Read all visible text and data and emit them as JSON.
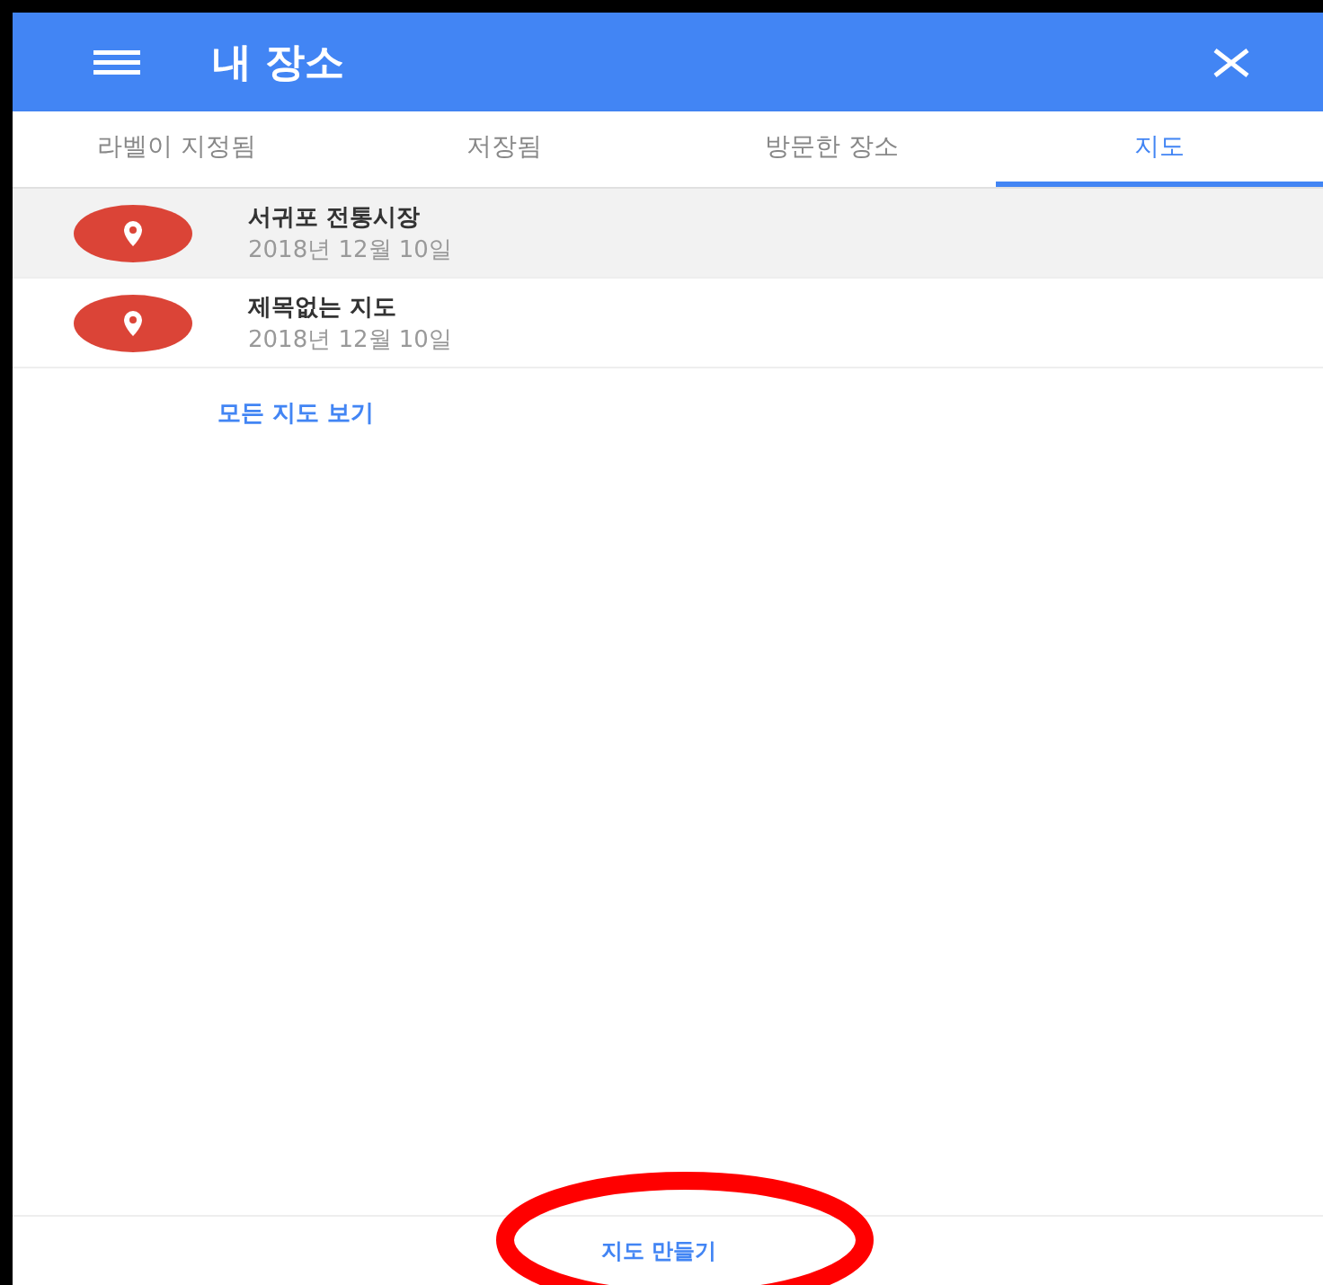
{
  "header": {
    "title": "내 장소"
  },
  "tabs": [
    {
      "label": "라벨이 지정됨",
      "selected": false
    },
    {
      "label": "저장됨",
      "selected": false
    },
    {
      "label": "방문한 장소",
      "selected": false
    },
    {
      "label": "지도",
      "selected": true
    }
  ],
  "maps": [
    {
      "name": "서귀포 전통시장",
      "date": "2018년 12월 10일",
      "selected": true
    },
    {
      "name": "제목없는 지도",
      "date": "2018년 12월 10일",
      "selected": false
    }
  ],
  "view_all_link": "모든 지도 보기",
  "footer": {
    "create_button": "지도 만들기",
    "highlighted": true
  }
}
